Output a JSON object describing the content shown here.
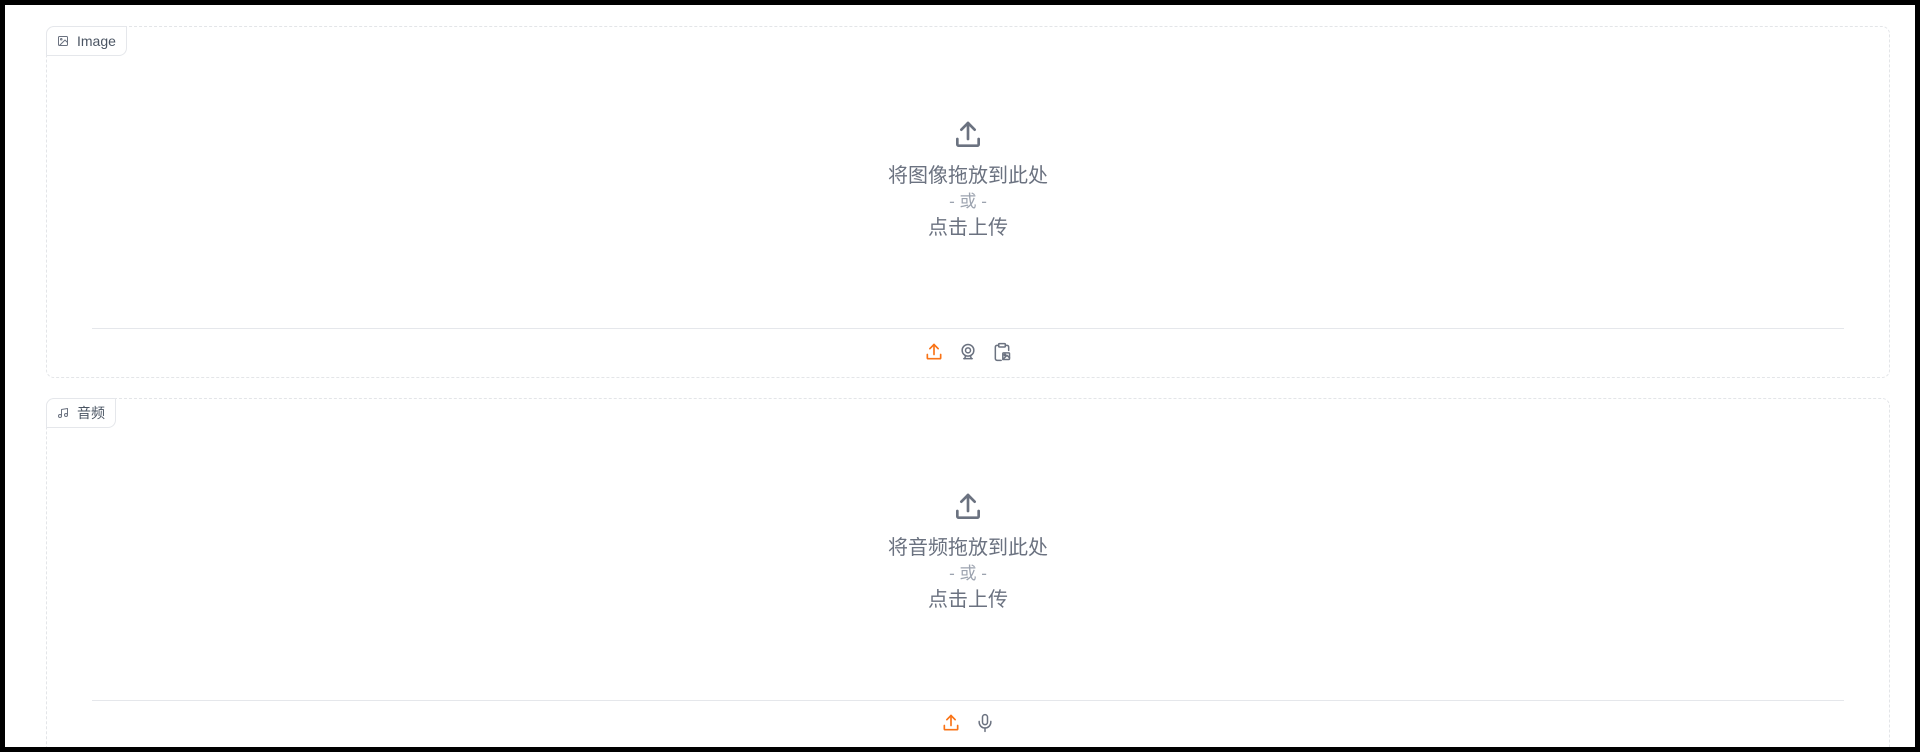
{
  "image_block": {
    "label": "Image",
    "label_icon": "image-icon",
    "drop_text": "将图像拖放到此处",
    "or_text": "- 或 -",
    "click_text": "点击上传",
    "toolbar": [
      {
        "name": "upload",
        "icon": "upload-icon",
        "active": true
      },
      {
        "name": "webcam",
        "icon": "webcam-icon",
        "active": false
      },
      {
        "name": "clipboard",
        "icon": "clipboard-icon",
        "active": false
      }
    ]
  },
  "audio_block": {
    "label": "音频",
    "label_icon": "music-note-icon",
    "drop_text": "将音频拖放到此处",
    "or_text": "- 或 -",
    "click_text": "点击上传",
    "toolbar": [
      {
        "name": "upload",
        "icon": "upload-icon",
        "active": true
      },
      {
        "name": "microphone",
        "icon": "microphone-icon",
        "active": false
      }
    ]
  },
  "colors": {
    "accent": "#f97316",
    "icon_gray": "#6b7280",
    "text_gray": "#6b7280",
    "muted_gray": "#9ca3af",
    "border": "#e5e7eb"
  }
}
